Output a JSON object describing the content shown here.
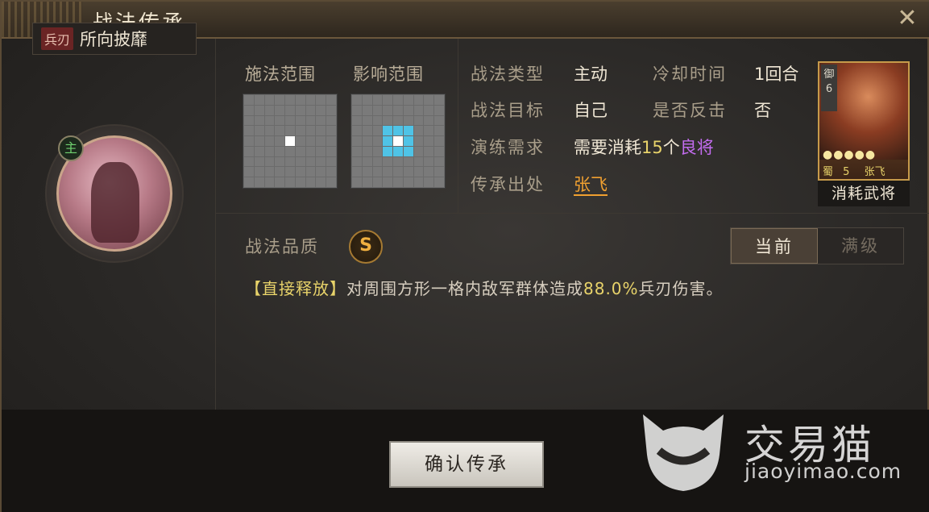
{
  "window": {
    "title": "战法传承",
    "close_icon": "✕"
  },
  "skill": {
    "weapon_tag": "兵刃",
    "name": "所向披靡",
    "role_badge": "主"
  },
  "range": {
    "cast_label": "施法范围",
    "effect_label": "影响范围",
    "grid_size": 9,
    "cast_center": true,
    "effect_radius": 1,
    "highlight_color": "#4fc3e6"
  },
  "info": {
    "type_label": "战法类型",
    "type_value": "主动",
    "cooldown_label": "冷却时间",
    "cooldown_value": "1回合",
    "target_label": "战法目标",
    "target_value": "自己",
    "counter_label": "是否反击",
    "counter_value": "否",
    "requirement_label": "演练需求",
    "requirement_prefix": "需要消耗",
    "requirement_count": "15",
    "requirement_unit": "个",
    "requirement_grade": "良将",
    "source_label": "传承出处",
    "source_value": "张飞"
  },
  "card": {
    "def_label": "御",
    "level": "6",
    "stars": "●●●●●",
    "faction": "蜀",
    "cost": "5",
    "hero": "张飞",
    "caption": "消耗武将"
  },
  "quality": {
    "label": "战法品质",
    "grade": "S"
  },
  "toggle": {
    "current": "当前",
    "max": "满级"
  },
  "description": {
    "tag": "【直接释放】",
    "text_a": "对周围方形一格内敌军群体造成",
    "pct": "88.0%",
    "text_b": "兵刃伤害。"
  },
  "confirm": {
    "label": "确认传承"
  },
  "watermark": {
    "name": "交易猫",
    "url": "jiaoyimao.com"
  }
}
